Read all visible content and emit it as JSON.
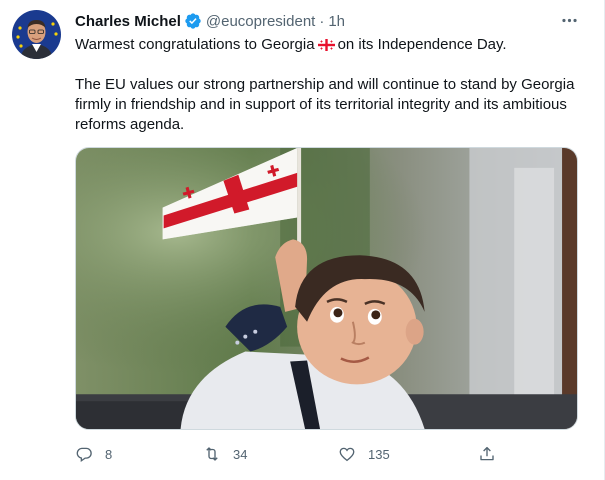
{
  "tweet": {
    "author_name": "Charles Michel",
    "handle": "@eucopresident",
    "separator": "·",
    "time": "1h",
    "text_line1_before": "Warmest congratulations to Georgia",
    "text_line1_after": "on its Independence Day.",
    "text_paragraph2": "The EU values our strong partnership and will continue to stand by Georgia firmly in friendship and in support of its territorial integrity and its ambitious reforms agenda.",
    "flag_emoji_name": "georgia-flag-icon"
  },
  "actions": {
    "replies": "8",
    "retweets": "34",
    "likes": "135"
  },
  "colors": {
    "verified_blue": "#1d9bf0",
    "muted_gray": "#536471",
    "georgia_red": "#e8112d"
  }
}
